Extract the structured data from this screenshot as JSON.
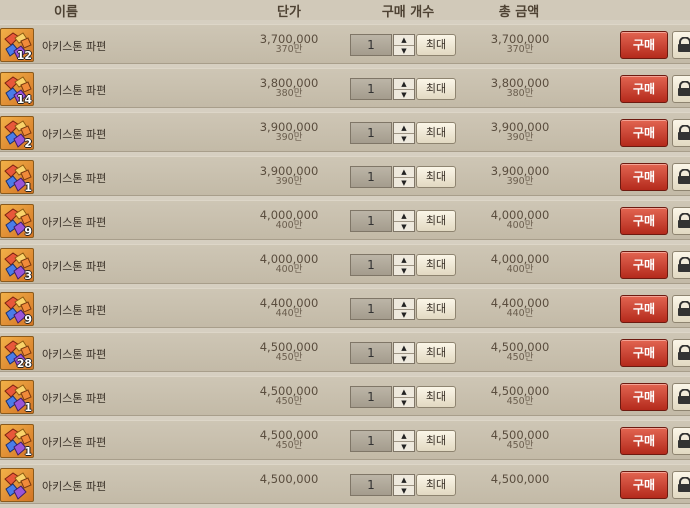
{
  "header": {
    "name_col": "이름",
    "unit_price_col": "단가",
    "qty_col": "구매 개수",
    "total_col": "총 금액"
  },
  "buttons": {
    "max_label": "최대",
    "buy_label": "구매"
  },
  "items": [
    {
      "count": "12",
      "name": "아키스톤 파편",
      "unit_price": "3,700,000",
      "unit_price_short": "370만",
      "qty": "1",
      "total": "3,700,000",
      "total_short": "370만"
    },
    {
      "count": "14",
      "name": "아키스톤 파편",
      "unit_price": "3,800,000",
      "unit_price_short": "380만",
      "qty": "1",
      "total": "3,800,000",
      "total_short": "380만"
    },
    {
      "count": "2",
      "name": "아키스톤 파편",
      "unit_price": "3,900,000",
      "unit_price_short": "390만",
      "qty": "1",
      "total": "3,900,000",
      "total_short": "390만"
    },
    {
      "count": "1",
      "name": "아키스톤 파편",
      "unit_price": "3,900,000",
      "unit_price_short": "390만",
      "qty": "1",
      "total": "3,900,000",
      "total_short": "390만"
    },
    {
      "count": "9",
      "name": "아키스톤 파편",
      "unit_price": "4,000,000",
      "unit_price_short": "400만",
      "qty": "1",
      "total": "4,000,000",
      "total_short": "400만"
    },
    {
      "count": "3",
      "name": "아키스톤 파편",
      "unit_price": "4,000,000",
      "unit_price_short": "400만",
      "qty": "1",
      "total": "4,000,000",
      "total_short": "400만"
    },
    {
      "count": "9",
      "name": "아키스톤 파편",
      "unit_price": "4,400,000",
      "unit_price_short": "440만",
      "qty": "1",
      "total": "4,400,000",
      "total_short": "440만"
    },
    {
      "count": "28",
      "name": "아키스톤 파편",
      "unit_price": "4,500,000",
      "unit_price_short": "450만",
      "qty": "1",
      "total": "4,500,000",
      "total_short": "450만"
    },
    {
      "count": "1",
      "name": "아키스톤 파편",
      "unit_price": "4,500,000",
      "unit_price_short": "450만",
      "qty": "1",
      "total": "4,500,000",
      "total_short": "450만"
    },
    {
      "count": "1",
      "name": "아키스톤 파편",
      "unit_price": "4,500,000",
      "unit_price_short": "450만",
      "qty": "1",
      "total": "4,500,000",
      "total_short": "450만"
    },
    {
      "count": "",
      "name": "아키스톤 파편",
      "unit_price": "4,500,000",
      "unit_price_short": "",
      "qty": "1",
      "total": "4,500,000",
      "total_short": ""
    }
  ],
  "icons": {
    "item": "arkstone-fragment-icon",
    "up": "arrow-up-icon",
    "down": "arrow-down-icon",
    "lock": "lock-icon"
  },
  "colors": {
    "background": "#d6cfc1",
    "buy_button": "#c73a28",
    "item_icon": "#e69236"
  }
}
